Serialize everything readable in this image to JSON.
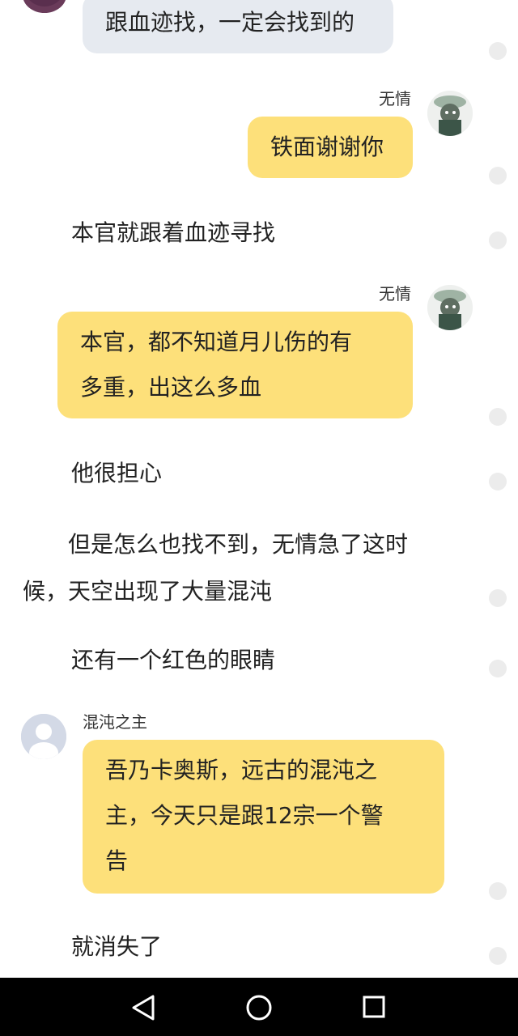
{
  "messages": [
    {
      "type": "bubble",
      "side": "left",
      "style": "grey",
      "text": "跟血迹找，一定会找到的"
    },
    {
      "type": "bubble",
      "side": "right",
      "style": "yellow",
      "speaker": "无情",
      "text": "铁面谢谢你"
    },
    {
      "type": "narration",
      "text": "本官就跟着血迹寻找"
    },
    {
      "type": "bubble",
      "side": "right",
      "style": "yellow",
      "speaker": "无情",
      "lines": [
        "本官，都不知道月儿伤的有",
        "多重，出这么多血"
      ]
    },
    {
      "type": "narration",
      "text": "他很担心"
    },
    {
      "type": "narration",
      "lines": [
        "　　但是怎么也找不到，无情急了这时",
        "候，天空出现了大量混沌"
      ]
    },
    {
      "type": "narration",
      "text": "还有一个红色的眼睛"
    },
    {
      "type": "bubble",
      "side": "left",
      "style": "yellow",
      "speaker": "混沌之主",
      "lines": [
        "吾乃卡奥斯，远古的混沌之",
        "主，今天只是跟12宗一个警",
        "告"
      ]
    },
    {
      "type": "narration",
      "text": "就消失了"
    }
  ],
  "nav": {
    "back_icon": "back-triangle-icon",
    "home_icon": "home-circle-icon",
    "recents_icon": "recents-square-icon"
  }
}
